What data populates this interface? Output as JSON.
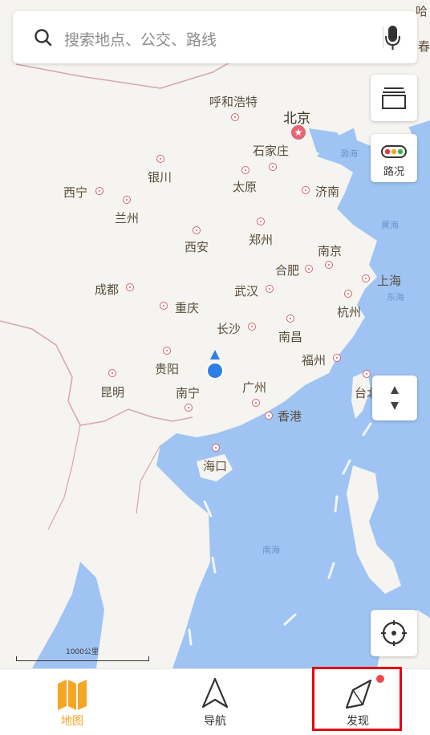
{
  "search": {
    "placeholder": "搜索地点、公交、路线"
  },
  "buttons": {
    "traffic_label": "路况"
  },
  "map": {
    "scale_label": "1000公里",
    "cities": {
      "beijing": "北京",
      "huhehaote": "呼和浩特",
      "shijiazhuang": "石家庄",
      "yinchuan": "银川",
      "xining": "西宁",
      "taiyuan": "太原",
      "jinan": "济南",
      "lanzhou": "兰州",
      "zhengzhou": "郑州",
      "xian": "西安",
      "nanjing": "南京",
      "hefei": "合肥",
      "shanghai": "上海",
      "chengdu": "成都",
      "wuhan": "武汉",
      "hangzhou": "杭州",
      "chongqing": "重庆",
      "changsha": "长沙",
      "nanchang": "南昌",
      "fuzhou": "福州",
      "guiyang": "贵阳",
      "kunming": "昆明",
      "nanning": "南宁",
      "guangzhou": "广州",
      "xianggang": "香港",
      "taibei": "台北",
      "haikou": "海口"
    },
    "edge_labels": {
      "ha": "哈",
      "chun": "春"
    },
    "waters": {
      "bohai": "渤海",
      "huanghai": "黄海",
      "donghai": "东海",
      "nanhai": "南海"
    }
  },
  "bottom_nav": {
    "tabs": [
      {
        "label": "地图",
        "active": true
      },
      {
        "label": "导航",
        "active": false
      },
      {
        "label": "发现",
        "active": false,
        "has_badge": true
      }
    ]
  },
  "colors": {
    "accent": "#f5a623",
    "land": "#f5f4f0",
    "sea": "#9fc4f3",
    "highlight": "#e60012",
    "badge": "#f2464b"
  }
}
